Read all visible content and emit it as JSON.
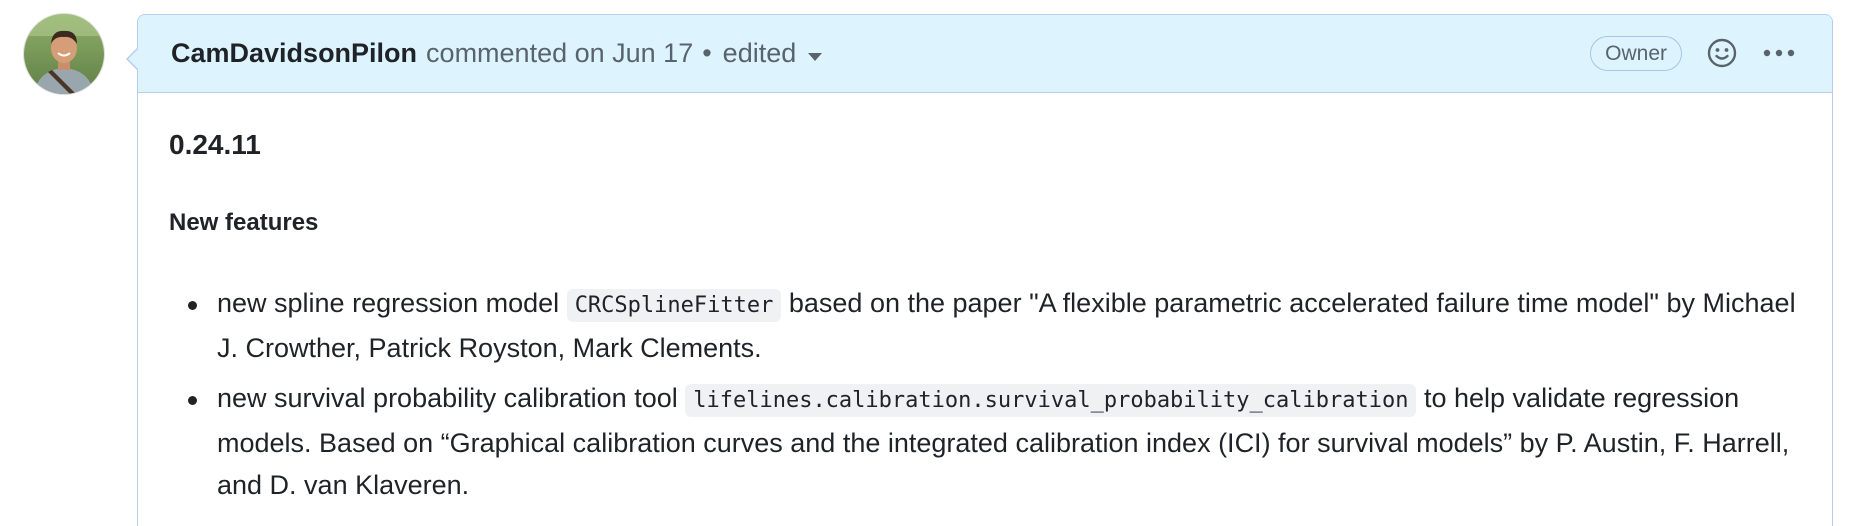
{
  "comment": {
    "author": "CamDavidsonPilon",
    "meta_text": "commented on Jun 17",
    "separator": "•",
    "edited_label": "edited",
    "role_badge": "Owner",
    "icons": {
      "avatar": "user-avatar",
      "reaction": "smiley-icon",
      "more": "kebab-horizontal-icon",
      "edited_dropdown": "caret-down-icon"
    },
    "colors": {
      "header_bg": "#ddf4ff",
      "border": "#b6cdee",
      "text": "#1f2328",
      "muted": "#59636e",
      "code_bg": "#eff1f3"
    }
  },
  "body": {
    "version_heading": "0.24.11",
    "section_heading": "New features",
    "items": [
      {
        "pre": "new spline regression model ",
        "code": "CRCSplineFitter",
        "post": " based on the paper \"A flexible parametric accelerated failure time model\" by Michael J. Crowther, Patrick Royston, Mark Clements."
      },
      {
        "pre": "new survival probability calibration tool ",
        "code": "lifelines.calibration.survival_probability_calibration",
        "post": " to help validate regression models. Based on “Graphical calibration curves and the integrated calibration index (ICI) for survival models” by P. Austin, F. Harrell, and D. van Klaveren."
      }
    ]
  }
}
